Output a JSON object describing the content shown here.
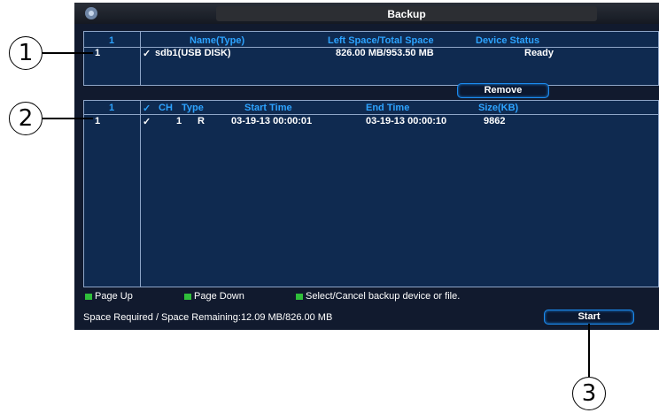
{
  "window": {
    "title": "Backup",
    "logo_icon": "camera-logo-icon"
  },
  "device_table": {
    "columns": [
      "1",
      "Name(Type)",
      "Left Space/Total Space",
      "Device Status"
    ],
    "rows": [
      {
        "index": "1",
        "check": "✓",
        "name": "sdb1(USB DISK)",
        "space": "826.00 MB/953.50 MB",
        "status": "Ready"
      }
    ]
  },
  "remove_button": "Remove",
  "file_table": {
    "columns": {
      "index": "1",
      "check": "✓",
      "ch": "CH",
      "type": "Type",
      "start": "Start Time",
      "end": "End Time",
      "size": "Size(KB)"
    },
    "rows": [
      {
        "index": "1",
        "check": "✓",
        "ch": "1",
        "type": "R",
        "start": "03-19-13 00:00:01",
        "end": "03-19-13 00:00:10",
        "size": "9862"
      }
    ]
  },
  "hints": {
    "page_up": "Page Up",
    "page_down": "Page Down",
    "select": "Select/Cancel backup device or file."
  },
  "space_text": "Space Required / Space Remaining:12.09 MB/826.00 MB",
  "start_button": "Start",
  "callouts": [
    "1",
    "2",
    "3"
  ],
  "colors": {
    "header_text": "#2da3ff",
    "panel_bg": "#0f2a50",
    "hint_icon": "#2fbf3a",
    "button_border": "#1b8bf0"
  }
}
